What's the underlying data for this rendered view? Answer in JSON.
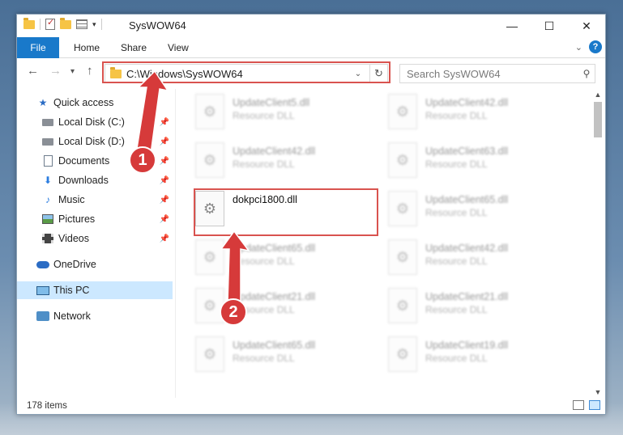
{
  "window": {
    "title": "SysWOW64",
    "controls": {
      "minimize": "—",
      "maximize": "☐",
      "close": "✕"
    }
  },
  "ribbon": {
    "tabs": [
      {
        "label": "File"
      },
      {
        "label": "Home"
      },
      {
        "label": "Share"
      },
      {
        "label": "View"
      }
    ],
    "help": "?"
  },
  "navbar": {
    "address": "C:\\Windows\\SysWOW64",
    "search_placeholder": "Search SysWOW64"
  },
  "sidebar": {
    "items": [
      {
        "label": "Quick access",
        "icon": "star-icon",
        "pinned": false
      },
      {
        "label": "Local Disk (C:)",
        "icon": "disk-icon",
        "pinned": true
      },
      {
        "label": "Local Disk (D:)",
        "icon": "disk-icon",
        "pinned": true
      },
      {
        "label": "Documents",
        "icon": "documents-icon",
        "pinned": true
      },
      {
        "label": "Downloads",
        "icon": "download-icon",
        "pinned": true
      },
      {
        "label": "Music",
        "icon": "music-icon",
        "pinned": true
      },
      {
        "label": "Pictures",
        "icon": "pictures-icon",
        "pinned": true
      },
      {
        "label": "Videos",
        "icon": "videos-icon",
        "pinned": true
      },
      {
        "label": "OneDrive",
        "icon": "onedrive-icon",
        "pinned": false
      },
      {
        "label": "This PC",
        "icon": "pc-icon",
        "pinned": false,
        "selected": true
      },
      {
        "label": "Network",
        "icon": "network-icon",
        "pinned": false
      }
    ]
  },
  "files": [
    {
      "name": "UpdateClient5.dll",
      "type": "Resource DLL",
      "highlighted": false
    },
    {
      "name": "UpdateClient42.dll",
      "type": "Resource DLL",
      "highlighted": false
    },
    {
      "name": "UpdateClient42.dll",
      "type": "Resource DLL",
      "highlighted": false
    },
    {
      "name": "UpdateClient63.dll",
      "type": "Resource DLL",
      "highlighted": false
    },
    {
      "name": "dokpci1800.dll",
      "type": "",
      "highlighted": true
    },
    {
      "name": "UpdateClient65.dll",
      "type": "Resource DLL",
      "highlighted": false
    },
    {
      "name": "UpdateClient65.dll",
      "type": "Resource DLL",
      "highlighted": false
    },
    {
      "name": "UpdateClient42.dll",
      "type": "Resource DLL",
      "highlighted": false
    },
    {
      "name": "UpdateClient21.dll",
      "type": "Resource DLL",
      "highlighted": false
    },
    {
      "name": "UpdateClient21.dll",
      "type": "Resource DLL",
      "highlighted": false
    },
    {
      "name": "UpdateClient65.dll",
      "type": "Resource DLL",
      "highlighted": false
    },
    {
      "name": "UpdateClient19.dll",
      "type": "Resource DLL",
      "highlighted": false
    }
  ],
  "status": {
    "count": "178 items"
  },
  "annotations": {
    "step1": "1",
    "step2": "2",
    "color": "#d63a3a"
  }
}
